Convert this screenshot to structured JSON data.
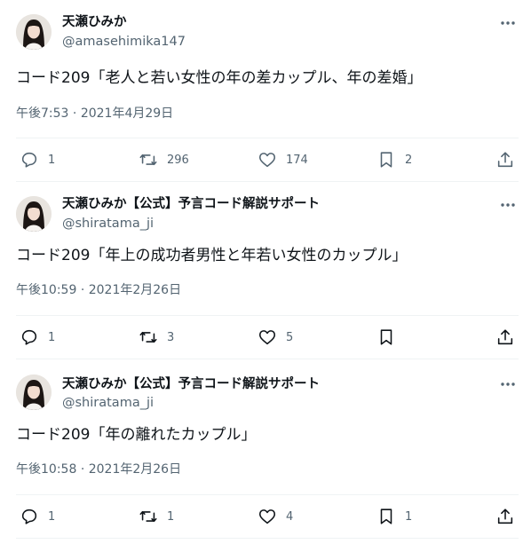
{
  "tweets": [
    {
      "author_name": "天瀬ひみか",
      "handle": "@amasehimika147",
      "text": "コード209「老人と若い女性の年の差カップル、年の差婚」",
      "time": "午後7:53",
      "separator": "·",
      "date": "2021年4月29日",
      "replies": "1",
      "retweets": "296",
      "likes": "174",
      "bookmarks": "2"
    },
    {
      "author_name": "天瀬ひみか【公式】予言コード解説サポート",
      "handle": "@shiratama_ji",
      "text": "コード209「年上の成功者男性と年若い女性のカップル」",
      "time": "午後10:59",
      "separator": "·",
      "date": "2021年2月26日",
      "replies": "1",
      "retweets": "3",
      "likes": "5",
      "bookmarks": ""
    },
    {
      "author_name": "天瀬ひみか【公式】予言コード解説サポート",
      "handle": "@shiratama_ji",
      "text": "コード209「年の離れたカップル」",
      "time": "午後10:58",
      "separator": "·",
      "date": "2021年2月26日",
      "replies": "1",
      "retweets": "1",
      "likes": "4",
      "bookmarks": "1"
    }
  ],
  "icons": {
    "more": "more-dots-icon",
    "reply": "reply-bubble-icon",
    "retweet": "retweet-icon",
    "like": "heart-icon",
    "bookmark": "bookmark-icon",
    "share": "share-icon"
  },
  "colors": {
    "text": "#0f1419",
    "secondary": "#536471",
    "divider": "#eff3f4"
  }
}
